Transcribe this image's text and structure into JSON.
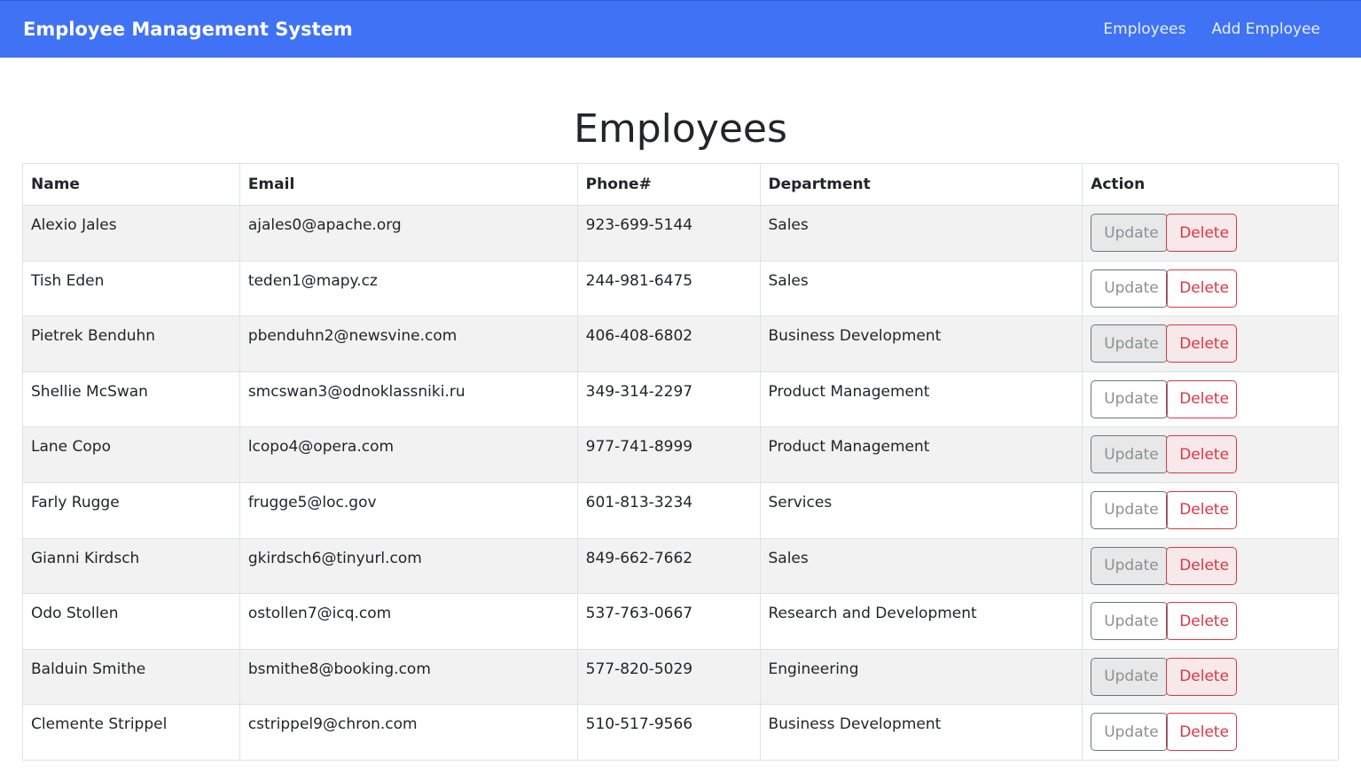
{
  "navbar": {
    "brand": "Employee Management System",
    "links": [
      {
        "label": "Employees"
      },
      {
        "label": "Add Employee"
      }
    ]
  },
  "page": {
    "title": "Employees"
  },
  "table": {
    "headers": [
      "Name",
      "Email",
      "Phone#",
      "Department",
      "Action"
    ],
    "update_label": "Update",
    "delete_label": "Delete",
    "rows": [
      {
        "name": "Alexio Jales",
        "email": "ajales0@apache.org",
        "phone": "923-699-5144",
        "department": "Sales"
      },
      {
        "name": "Tish Eden",
        "email": "teden1@mapy.cz",
        "phone": "244-981-6475",
        "department": "Sales"
      },
      {
        "name": "Pietrek Benduhn",
        "email": "pbenduhn2@newsvine.com",
        "phone": "406-408-6802",
        "department": "Business Development"
      },
      {
        "name": "Shellie McSwan",
        "email": "smcswan3@odnoklassniki.ru",
        "phone": "349-314-2297",
        "department": "Product Management"
      },
      {
        "name": "Lane Copo",
        "email": "lcopo4@opera.com",
        "phone": "977-741-8999",
        "department": "Product Management"
      },
      {
        "name": "Farly Rugge",
        "email": "frugge5@loc.gov",
        "phone": "601-813-3234",
        "department": "Services"
      },
      {
        "name": "Gianni Kirdsch",
        "email": "gkirdsch6@tinyurl.com",
        "phone": "849-662-7662",
        "department": "Sales"
      },
      {
        "name": "Odo Stollen",
        "email": "ostollen7@icq.com",
        "phone": "537-763-0667",
        "department": "Research and Development"
      },
      {
        "name": "Balduin Smithe",
        "email": "bsmithe8@booking.com",
        "phone": "577-820-5029",
        "department": "Engineering"
      },
      {
        "name": "Clemente Strippel",
        "email": "cstrippel9@chron.com",
        "phone": "510-517-9566",
        "department": "Business Development"
      }
    ]
  },
  "colors": {
    "navbar_bg": "#3f72f5",
    "delete": "#dc3545",
    "update": "#6c757d"
  }
}
